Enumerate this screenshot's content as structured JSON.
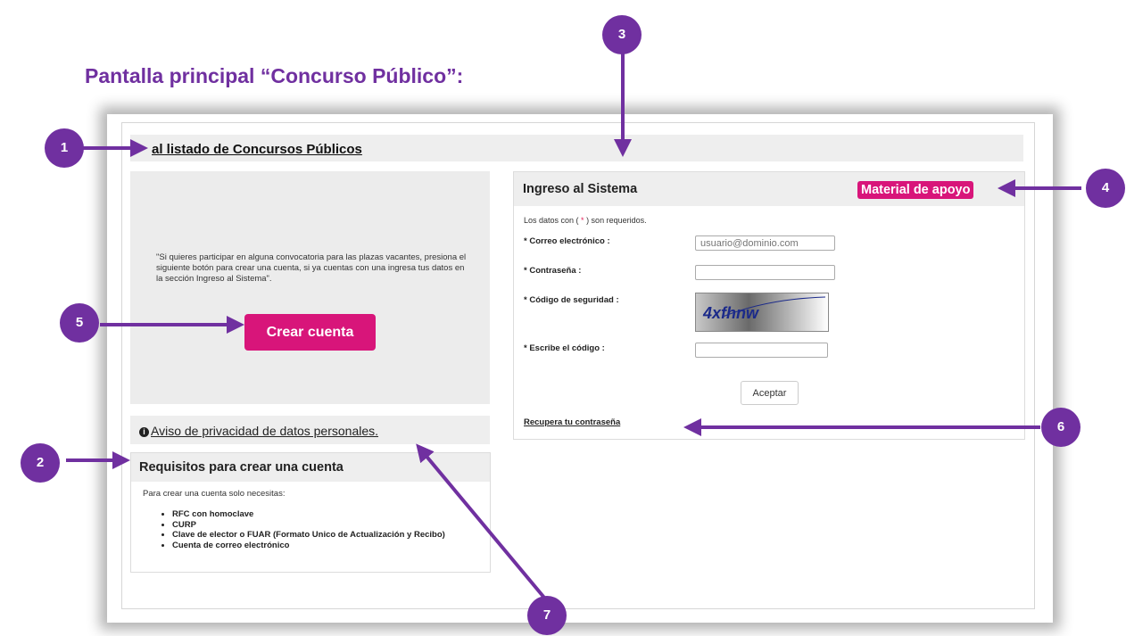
{
  "heading": "Pantalla principal “Concurso Público”:",
  "top_link": "al listado de Concursos Públicos",
  "left_panel": {
    "quote": "\"Si quieres participar en alguna convocatoria para las plazas vacantes, presiona el siguiente botón para crear una cuenta, si ya cuentas con una ingresa tus datos en la sección Ingreso al Sistema\".",
    "create_button": "Crear cuenta"
  },
  "privacy_link": "Aviso de privacidad de datos personales.",
  "requirements": {
    "title": "Requisitos para crear una cuenta",
    "intro": "Para crear una cuenta solo necesitas:",
    "items": [
      "RFC con homoclave",
      "CURP",
      "Clave de elector o FUAR (Formato Unico de Actualización y Recibo)",
      "Cuenta de correo electrónico"
    ]
  },
  "login": {
    "title": "Ingreso al Sistema",
    "support_button": "Material de apoyo",
    "required_note_before": "Los datos con (",
    "required_star": " * ",
    "required_note_after": ") son requeridos.",
    "email_label": "* Correo electrónico :",
    "email_placeholder": "usuario@dominio.com",
    "password_label": "* Contraseña :",
    "captcha_label": "* Código de seguridad :",
    "captcha_text": "4xfhnw",
    "code_label": "* Escribe el código :",
    "submit_button": "Aceptar",
    "recover_link": "Recupera tu contraseña"
  },
  "callouts": [
    "1",
    "2",
    "3",
    "4",
    "5",
    "6",
    "7"
  ],
  "colors": {
    "callout": "#7030a0",
    "accent_button": "#d8157a",
    "panel_gray": "#eeeeee"
  }
}
